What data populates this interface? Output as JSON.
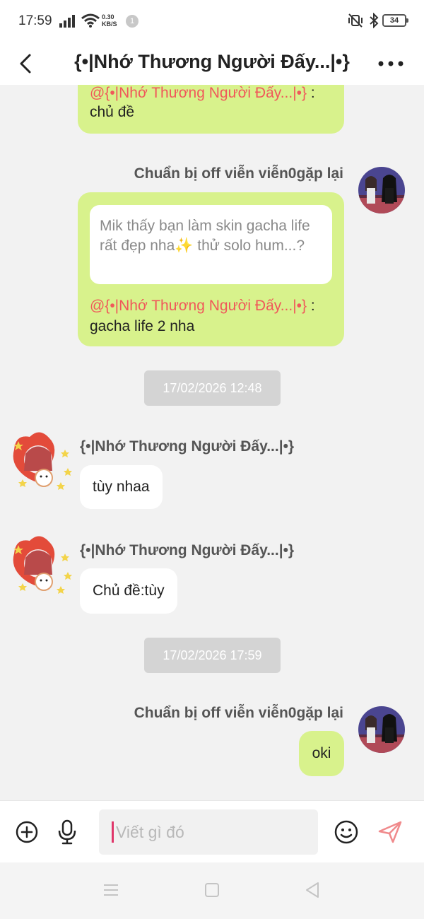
{
  "status_bar": {
    "time": "17:59",
    "network_speed_value": "0.30",
    "network_speed_unit": "KB/S",
    "notification_count": "1",
    "battery": "34"
  },
  "header": {
    "title": "{•|Nhớ Thương Người Đấy...|•}"
  },
  "messages": {
    "m1": {
      "mention": "@{•|Nhớ Thương Người Đấy...|•}",
      "mention_suffix": " :",
      "text": "chủ đề"
    },
    "m2": {
      "sender": "Chuẩn bị off viễn viễn0gặp lại",
      "quote": "Mik thấy bạn làm skin gacha life rất đẹp nha✨ thử solo hum...?",
      "mention": "@{•|Nhớ Thương Người Đấy...|•}",
      "mention_suffix": " :",
      "text": "gacha life 2 nha"
    },
    "ts1": "17/02/2026 12:48",
    "m3": {
      "sender": "{•|Nhớ Thương Người Đấy...|•}",
      "text": "tùy nhaa"
    },
    "m4": {
      "sender": "{•|Nhớ Thương Người Đấy...|•}",
      "text": "Chủ đề:tùy"
    },
    "ts2": "17/02/2026 17:59",
    "m5": {
      "sender": "Chuẩn bị off viễn viễn0gặp lại",
      "text": "oki"
    }
  },
  "input": {
    "placeholder": "Viết gì đó"
  },
  "colors": {
    "own_bubble": "#d8f28c",
    "mention": "#f0585a",
    "timestamp_bg": "#d4d4d4",
    "send_icon": "#f08a8c",
    "cursor": "#e0366a"
  },
  "icons": [
    "back-icon",
    "more-icon",
    "plus-circle-icon",
    "microphone-icon",
    "emoji-icon",
    "send-icon",
    "nav-menu-icon",
    "nav-home-icon",
    "nav-back-icon"
  ]
}
